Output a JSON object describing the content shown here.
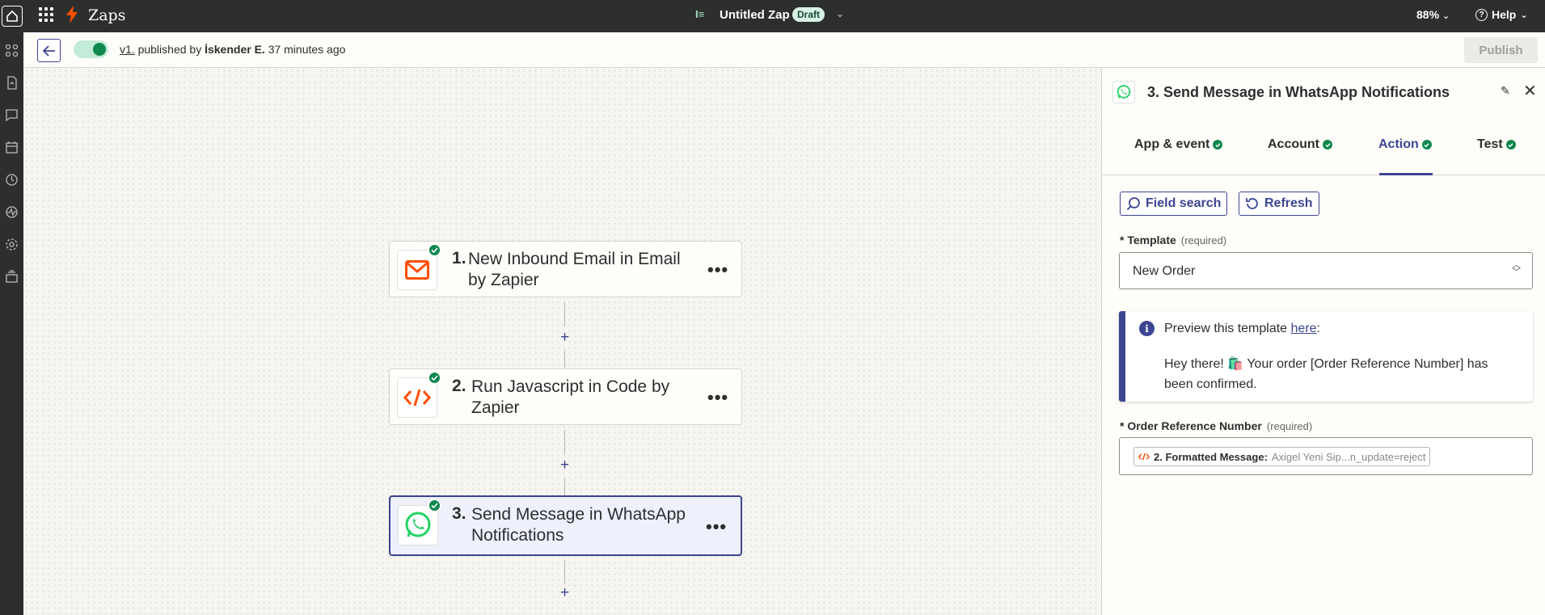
{
  "topbar": {
    "app_name": "Zaps",
    "zap_name": "Untitled Zap",
    "status_badge": "Draft",
    "zoom": "88%",
    "help": "Help"
  },
  "subbar": {
    "version": "v1.",
    "published_by": "published by",
    "author": "İskender E.",
    "time_ago": "37 minutes ago",
    "publish_label": "Publish"
  },
  "steps": [
    {
      "number": "1.",
      "title": "New Inbound Email in Email by Zapier",
      "app_icon": "email-icon"
    },
    {
      "number": "2.",
      "title": "Run Javascript in Code by Zapier",
      "app_icon": "code-icon"
    },
    {
      "number": "3.",
      "title": "Send Message in WhatsApp Notifications",
      "app_icon": "whatsapp-icon"
    }
  ],
  "panel": {
    "title": "3. Send Message in WhatsApp Notifications",
    "tabs": [
      {
        "label": "App & event"
      },
      {
        "label": "Account"
      },
      {
        "label": "Action"
      },
      {
        "label": "Test"
      }
    ],
    "active_tab": "Action",
    "field_search_label": "Field search",
    "refresh_label": "Refresh",
    "template_label": "Template",
    "required_text": "(required)",
    "template_value": "New Order",
    "preview_prefix": "Preview this template ",
    "preview_link": "here",
    "preview_suffix": ":",
    "preview_message": "Hey there! 🛍️ Your order [Order Reference Number] has been confirmed.",
    "order_ref_label": "Order Reference Number",
    "mapped_key": "2. Formatted Message:",
    "mapped_value": "Axigel Yeni Sip...n_update=reject"
  },
  "colors": {
    "accent": "#3d4592",
    "success": "#0f884e",
    "brand_orange": "#ff4f00",
    "whatsapp": "#25d366"
  }
}
